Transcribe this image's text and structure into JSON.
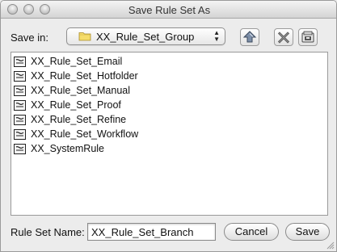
{
  "window": {
    "title": "Save Rule Set As"
  },
  "location": {
    "label": "Save in:",
    "folder": "XX_Rule_Set_Group"
  },
  "toolbar": {
    "up_icon": "up-folder-icon",
    "delete_icon": "delete-icon",
    "new_folder_icon": "new-folder-icon"
  },
  "files": [
    {
      "name": "XX_Rule_Set_Email",
      "icon": "rule-set-file-icon"
    },
    {
      "name": "XX_Rule_Set_Hotfolder",
      "icon": "rule-set-file-icon"
    },
    {
      "name": "XX_Rule_Set_Manual",
      "icon": "rule-set-file-icon"
    },
    {
      "name": "XX_Rule_Set_Proof",
      "icon": "rule-set-file-icon"
    },
    {
      "name": "XX_Rule_Set_Refine",
      "icon": "rule-set-file-icon"
    },
    {
      "name": "XX_Rule_Set_Workflow",
      "icon": "rule-set-file-icon"
    },
    {
      "name": "XX_SystemRule",
      "icon": "rule-set-file-icon"
    }
  ],
  "name_field": {
    "label": "Rule Set Name:",
    "value": "XX_Rule_Set_Branch"
  },
  "buttons": {
    "cancel": "Cancel",
    "save": "Save"
  },
  "colors": {
    "window_bg": "#ececec",
    "folder_yellow": "#f5dc6a"
  }
}
